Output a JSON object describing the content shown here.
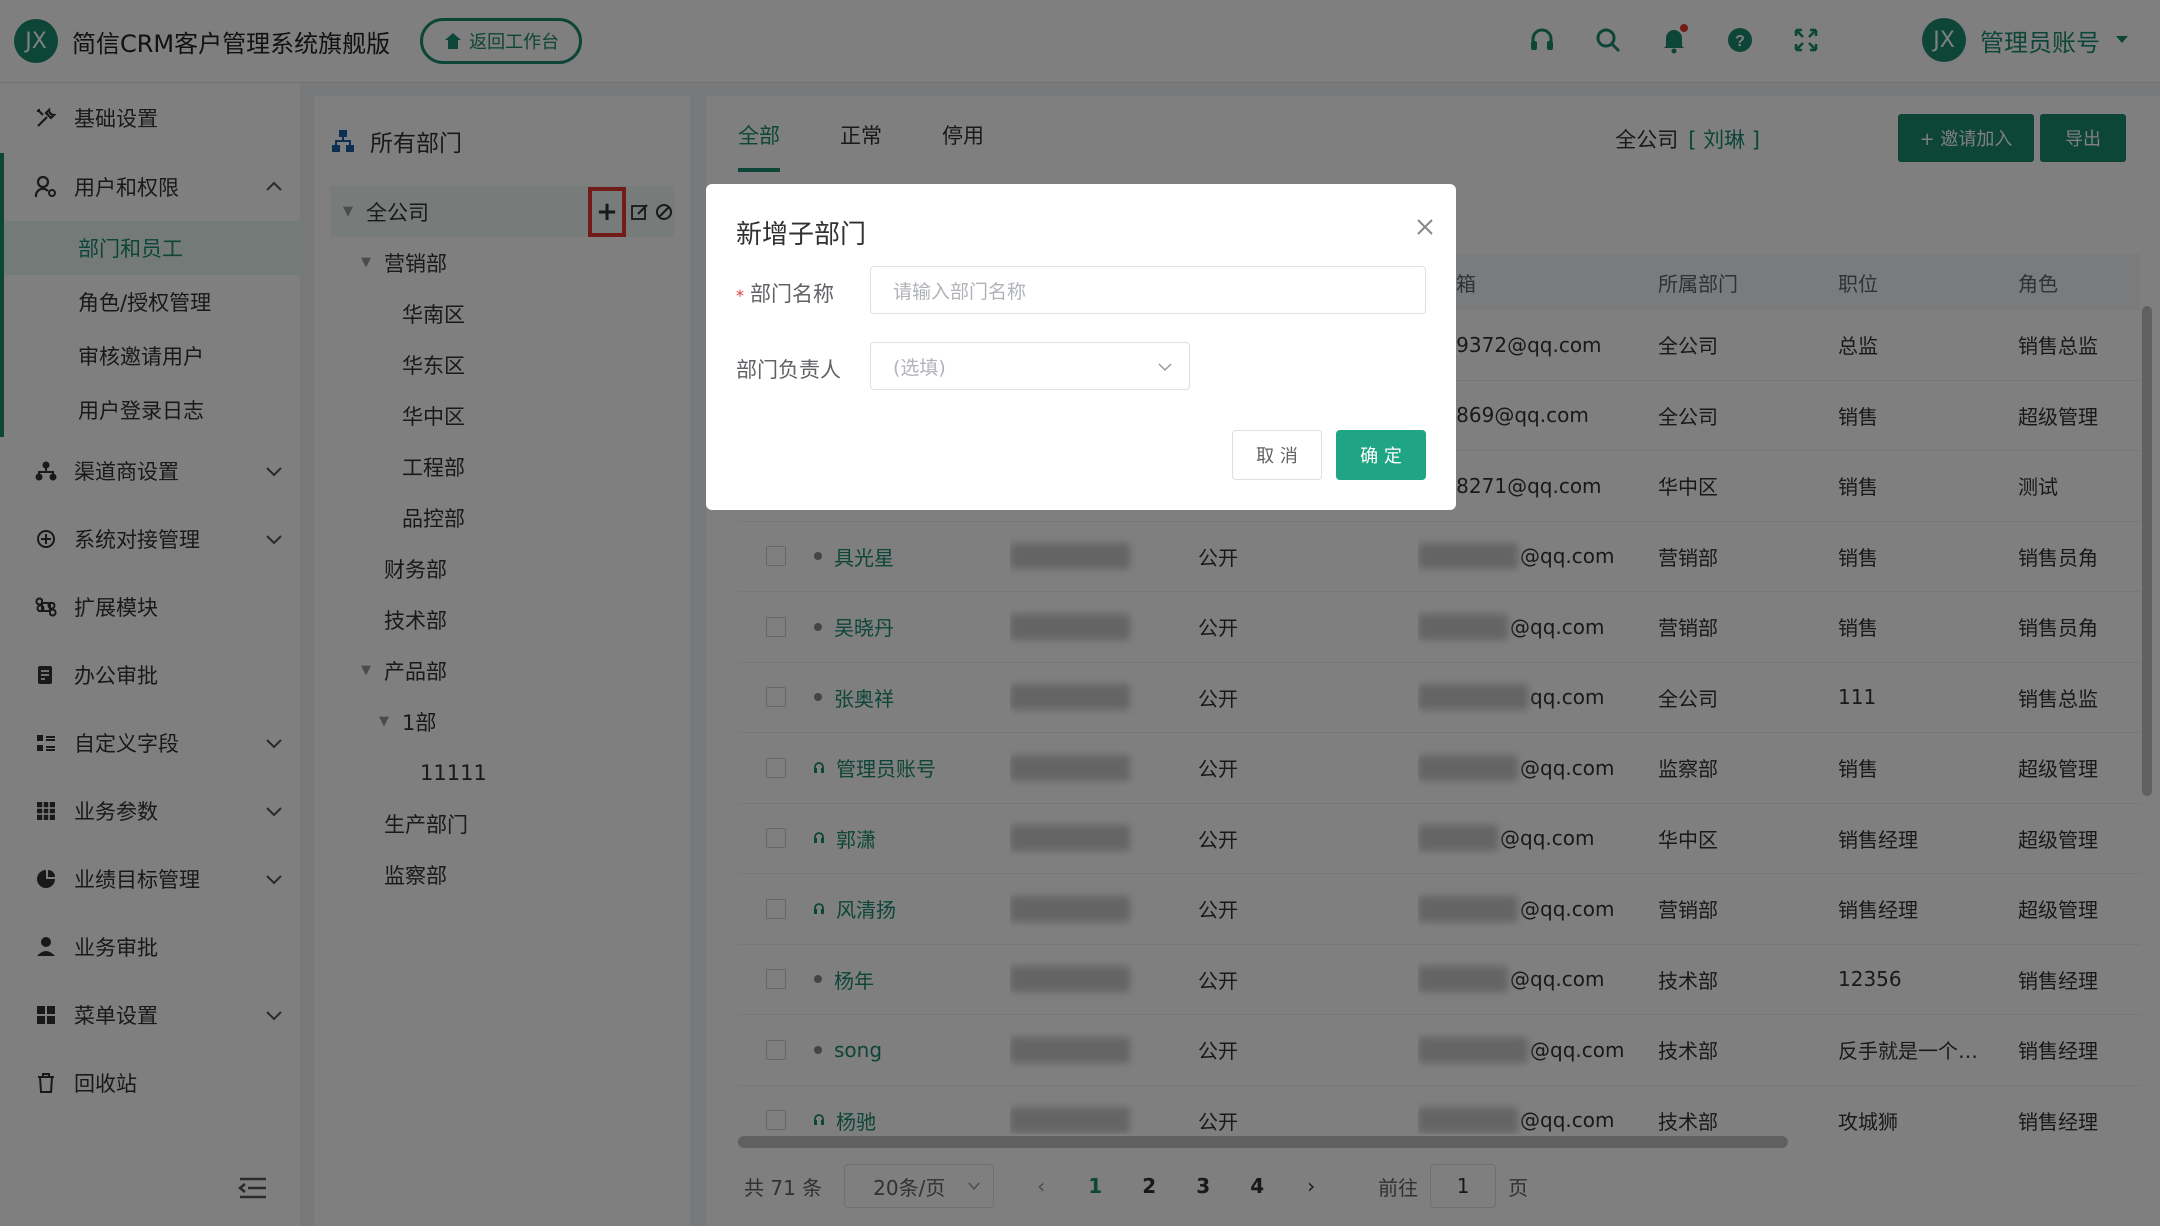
{
  "header": {
    "logo_text": "JX",
    "app_title": "简信CRM客户管理系统旗舰版",
    "back_button": "返回工作台",
    "user_avatar": "JX",
    "user_name": "管理员账号",
    "icons": [
      "headset-icon",
      "search-icon",
      "bell-icon",
      "help-icon",
      "fullscreen-icon"
    ]
  },
  "sidebar": {
    "items": [
      {
        "label": "基础设置",
        "icon": "wrench-icon"
      },
      {
        "label": "用户和权限",
        "icon": "user-key-icon",
        "expanded": true
      },
      {
        "label": "渠道商设置",
        "icon": "org-icon"
      },
      {
        "label": "系统对接管理",
        "icon": "connect-icon"
      },
      {
        "label": "扩展模块",
        "icon": "command-icon"
      },
      {
        "label": "办公审批",
        "icon": "doc-icon"
      },
      {
        "label": "自定义字段",
        "icon": "list-icon"
      },
      {
        "label": "业务参数",
        "icon": "grid-icon"
      },
      {
        "label": "业绩目标管理",
        "icon": "target-icon"
      },
      {
        "label": "业务审批",
        "icon": "person-icon"
      },
      {
        "label": "菜单设置",
        "icon": "apps-icon"
      },
      {
        "label": "回收站",
        "icon": "trash-icon"
      }
    ],
    "sub_items": [
      "部门和员工",
      "角色/授权管理",
      "审核邀请用户",
      "用户登录日志"
    ]
  },
  "dept": {
    "title": "所有部门",
    "nodes": [
      {
        "label": "全公司"
      },
      {
        "label": "营销部"
      },
      {
        "label": "华南区"
      },
      {
        "label": "华东区"
      },
      {
        "label": "华中区"
      },
      {
        "label": "工程部"
      },
      {
        "label": "品控部"
      },
      {
        "label": "财务部"
      },
      {
        "label": "技术部"
      },
      {
        "label": "产品部"
      },
      {
        "label": "1部"
      },
      {
        "label": "11111"
      },
      {
        "label": "生产部门"
      },
      {
        "label": "监察部"
      }
    ],
    "add_symbol": "+"
  },
  "main": {
    "tabs": [
      "全部",
      "正常",
      "停用"
    ],
    "company_label": "全公司",
    "company_person": "[ 刘琳 ]",
    "invite_button": "+ 邀请加入",
    "export_button": "导出",
    "columns": [
      "所属部门",
      "职位",
      "角色"
    ],
    "col_partial": "箱",
    "rows": [
      {
        "name": "",
        "vis": "",
        "email": "4609372@qq.com",
        "dept": "全公司",
        "pos": "总监",
        "role": "销售总监"
      },
      {
        "name": "",
        "vis": "",
        "email": "838869@qq.com",
        "dept": "全公司",
        "pos": "销售",
        "role": "超级管理"
      },
      {
        "name": "",
        "vis": "",
        "email": "6508271@qq.com",
        "dept": "华中区",
        "pos": "销售",
        "role": "测试"
      },
      {
        "name": "具光星",
        "vis": "公开",
        "email": "@qq.com",
        "dept": "营销部",
        "pos": "销售",
        "role": "销售员角"
      },
      {
        "name": "吴晓丹",
        "vis": "公开",
        "email": "@qq.com",
        "dept": "营销部",
        "pos": "销售",
        "role": "销售员角"
      },
      {
        "name": "张奥祥",
        "vis": "公开",
        "email": "qq.com",
        "dept": "全公司",
        "pos": "111",
        "role": "销售总监"
      },
      {
        "name": "管理员账号",
        "vis": "公开",
        "email": "@qq.com",
        "dept": "监察部",
        "pos": "销售",
        "role": "超级管理"
      },
      {
        "name": "郭潇",
        "vis": "公开",
        "email": "@qq.com",
        "dept": "华中区",
        "pos": "销售经理",
        "role": "超级管理"
      },
      {
        "name": "风清扬",
        "vis": "公开",
        "email": "@qq.com",
        "dept": "营销部",
        "pos": "销售经理",
        "role": "超级管理"
      },
      {
        "name": "杨年",
        "vis": "公开",
        "email": "@qq.com",
        "dept": "技术部",
        "pos": "12356",
        "role": "销售经理"
      },
      {
        "name": "song",
        "vis": "公开",
        "email": "@qq.com",
        "dept": "技术部",
        "pos": "反手就是一个…",
        "role": "销售经理"
      },
      {
        "name": "杨驰",
        "vis": "公开",
        "email": "@qq.com",
        "dept": "技术部",
        "pos": "攻城狮",
        "role": "销售经理"
      }
    ]
  },
  "pager": {
    "total": "共 71 条",
    "page_size": "20条/页",
    "pages": [
      "1",
      "2",
      "3",
      "4"
    ],
    "goto_label": "前往",
    "goto_value": "1",
    "page_suffix": "页"
  },
  "dialog": {
    "title": "新增子部门",
    "name_label": "部门名称",
    "name_placeholder": "请输入部门名称",
    "leader_label": "部门负责人",
    "leader_placeholder": "(选填)",
    "cancel": "取 消",
    "ok": "确 定"
  },
  "colors": {
    "accent": "#1a8a6e",
    "highlight": "#e53935"
  }
}
